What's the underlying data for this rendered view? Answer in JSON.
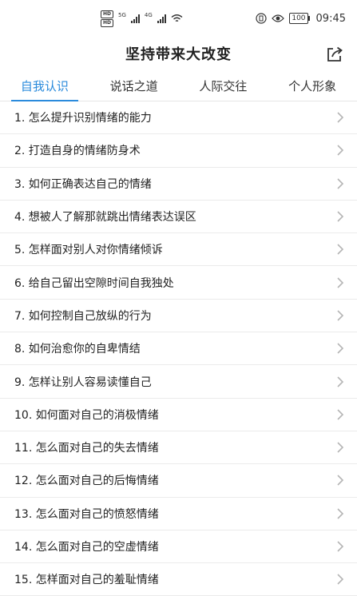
{
  "status_bar": {
    "hd1": "HD",
    "hd2": "HD",
    "net1": "5G",
    "net2": "4G",
    "battery": "100",
    "time": "09:45"
  },
  "header": {
    "title": "坚持带来大改变"
  },
  "tabs": [
    {
      "label": "自我认识",
      "active": true
    },
    {
      "label": "说话之道",
      "active": false
    },
    {
      "label": "人际交往",
      "active": false
    },
    {
      "label": "个人形象",
      "active": false
    }
  ],
  "items": [
    {
      "label": "1. 怎么提升识别情绪的能力"
    },
    {
      "label": "2. 打造自身的情绪防身术"
    },
    {
      "label": "3. 如何正确表达自己的情绪"
    },
    {
      "label": "4. 想被人了解那就跳出情绪表达误区"
    },
    {
      "label": "5. 怎样面对别人对你情绪倾诉"
    },
    {
      "label": "6. 给自己留出空隙时间自我独处"
    },
    {
      "label": "7. 如何控制自己放纵的行为"
    },
    {
      "label": "8. 如何治愈你的自卑情结"
    },
    {
      "label": "9. 怎样让别人容易读懂自己"
    },
    {
      "label": "10. 如何面对自己的消极情绪"
    },
    {
      "label": "11. 怎么面对自己的失去情绪"
    },
    {
      "label": "12. 怎么面对自己的后悔情绪"
    },
    {
      "label": "13. 怎么面对自己的愤怒情绪"
    },
    {
      "label": "14. 怎么面对自己的空虚情绪"
    },
    {
      "label": "15. 怎样面对自己的羞耻情绪"
    }
  ],
  "colors": {
    "accent": "#2b8bdc",
    "divider": "#ebebeb",
    "chevron": "#b5b5b5"
  },
  "icons": {
    "share": "share-icon",
    "chevron": "chevron-right-icon"
  }
}
